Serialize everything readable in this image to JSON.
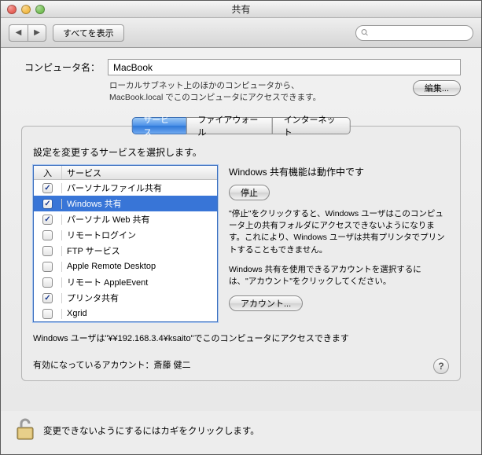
{
  "window": {
    "title": "共有"
  },
  "toolbar": {
    "show_all": "すべてを表示",
    "search_placeholder": ""
  },
  "computer_name": {
    "label": "コンピュータ名：",
    "value": "MacBook",
    "hint": "ローカルサブネット上のほかのコンピュータから、MacBook.local でこのコンピュータにアクセスできます。",
    "edit": "編集..."
  },
  "tabs": [
    {
      "label": "サービス",
      "selected": true
    },
    {
      "label": "ファイアウォール",
      "selected": false
    },
    {
      "label": "インターネット",
      "selected": false
    }
  ],
  "services": {
    "prompt": "設定を変更するサービスを選択します。",
    "col_on": "入",
    "col_name": "サービス",
    "items": [
      {
        "on": true,
        "name": "パーソナルファイル共有",
        "selected": false
      },
      {
        "on": true,
        "name": "Windows 共有",
        "selected": true
      },
      {
        "on": true,
        "name": "パーソナル Web 共有",
        "selected": false
      },
      {
        "on": false,
        "name": "リモートログイン",
        "selected": false
      },
      {
        "on": false,
        "name": "FTP サービス",
        "selected": false
      },
      {
        "on": false,
        "name": "Apple Remote Desktop",
        "selected": false
      },
      {
        "on": false,
        "name": "リモート AppleEvent",
        "selected": false
      },
      {
        "on": true,
        "name": "プリンタ共有",
        "selected": false
      },
      {
        "on": false,
        "name": "Xgrid",
        "selected": false
      }
    ]
  },
  "right": {
    "status": "Windows 共有機能は動作中です",
    "stop": "停止",
    "para1": "\"停止\"をクリックすると、Windows ユーザはこのコンピュータ上の共有フォルダにアクセスできないようになります。これにより、Windows ユーザは共有プリンタでプリントすることもできません。",
    "para2": "Windows 共有を使用できるアカウントを選択するには、\"アカウント\"をクリックしてください。",
    "account": "アカウント..."
  },
  "footer": {
    "access": "Windows ユーザは\"¥¥192.168.3.4¥ksaito\"でこのコンピュータにアクセスできます",
    "enabled": "有効になっているアカウント：斎藤 健二"
  },
  "lock": "変更できないようにするにはカギをクリックします。"
}
